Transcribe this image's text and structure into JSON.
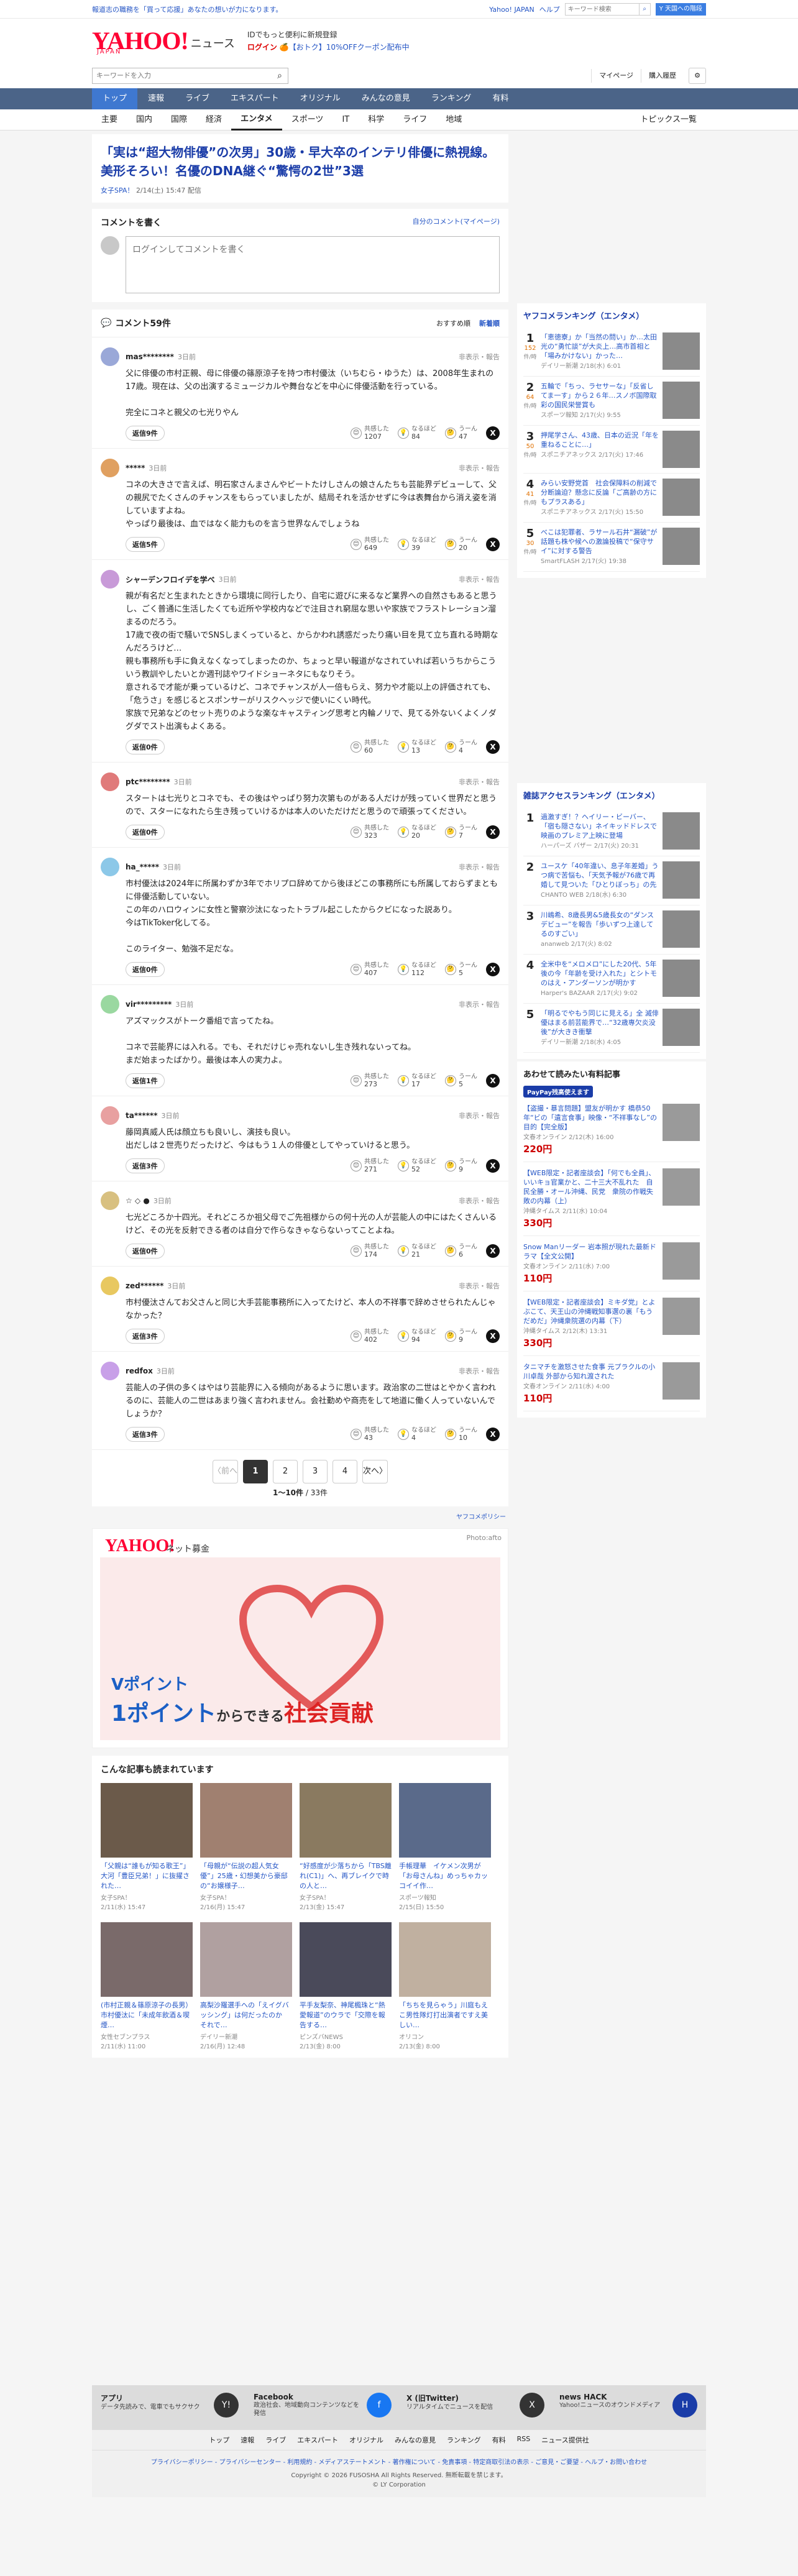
{
  "topbar": {
    "promo": "報道志の職務を「買って応援」あなたの想いが力になります。",
    "yahoo_japan": "Yahoo! JAPAN",
    "help": "ヘルプ",
    "mini_search_placeholder": "キーワード検索",
    "yj_button": "Y 天国への階段"
  },
  "header": {
    "logo": "YAHOO!",
    "logo_sub": "JAPAN",
    "service": "ニュース",
    "msg1": "IDでもっと便利に新規登録",
    "login": "ログイン",
    "msg2_pre": "【おトク】",
    "msg2": "10%OFFクーポン配布中"
  },
  "searchrow": {
    "placeholder": "キーワードを入力",
    "mypage": "マイページ",
    "history": "購入履歴"
  },
  "nav": [
    "トップ",
    "速報",
    "ライブ",
    "エキスパート",
    "オリジナル",
    "みんなの意見",
    "ランキング",
    "有料"
  ],
  "subnav": [
    "主要",
    "国内",
    "国際",
    "経済",
    "エンタメ",
    "スポーツ",
    "IT",
    "科学",
    "ライフ",
    "地域"
  ],
  "subnav_right": "トピックス一覧",
  "article": {
    "title": "「実は“超大物俳優”の次男」30歳・早大卒のインテリ俳優に熱視線。美形そろい！名優のDNA継ぐ“驚愕の2世”3選",
    "source": "女子SPA！",
    "date": "2/14(土) 15:47 配信"
  },
  "comment_form": {
    "heading": "コメントを書く",
    "mine": "自分のコメント(マイページ)",
    "placeholder": "ログインしてコメントを書く"
  },
  "comments_head": {
    "title": "コメント59件",
    "sort_rec": "おすすめ順",
    "sort_new": "新着順"
  },
  "react_labels": {
    "a": "共感した",
    "b": "なるほど",
    "c": "うーん",
    "report": "非表示・報告"
  },
  "comments": [
    {
      "user": "mas********",
      "time": "3日前",
      "body": "父に俳優の市村正親、母に俳優の篠原涼子を持つ市村優汰（いちむら・ゆうた）は、2008年生まれの17歳。現在は、父の出演するミュージカルや舞台などを中心に俳優活動を行っている。\n\n完全にコネと親父の七光りやん",
      "replies": "返信9件",
      "a": "1207",
      "b": "84",
      "c": "47"
    },
    {
      "user": "*****",
      "time": "3日前",
      "body": "コネの大きさで言えば、明石家さんまさんやビートたけしさんの娘さんたちも芸能界デビューして、父の親尻でたくさんのチャンスをもらっていましたが、結局それを活かせずに今は表舞台から消え姿を消していますよね。\nやっぱり最後は、血ではなく能力ものを言う世界なんでしょうね",
      "replies": "返信5件",
      "a": "649",
      "b": "39",
      "c": "20"
    },
    {
      "user": "シャーデンフロイデを学べ",
      "time": "3日前",
      "body": "親が有名だと生まれたときから環境に同行したり、自宅に遊びに来るなど業界への自然さもあると思うし、ごく普通に生活したくても近所や学校内などで注目され窮屈な思いや家族でフラストレーション溜まるのだろう。\n17歳で夜の街で騒いでSNSしまくっていると、からかわれ誘惑だったり痛い目を見て立ち直れる時期なんだろうけど…\n親も事務所も手に負えなくなってしまったのか、ちょっと早い報道がなされていれば若いうちからこういう教訓やしたいとか週刊誌やワイドショーネタにもなりそう。\n意されるで才能が乗っているけど、コネでチャンスが人一倍もらえ、努力や才能以上の評価されても、「危うさ」を感じるとスポンサーがリスクヘッジで使いにくい時代。\n家族で兄弟などのセット売りのような楽なキャスティング思考と内輪ノリで、見てる外ないくよくノダグダでスト出演もよくある。",
      "replies": "返信0件",
      "a": "60",
      "b": "13",
      "c": "4"
    },
    {
      "user": "ptc********",
      "time": "3日前",
      "body": "スタートは七光りとコネでも、その後はやっぱり努力次第ものがある人だけが残っていく世界だと思うので、スターになれたら生き残っていけるかは本人のいただけだと思うので頑張ってください。",
      "replies": "返信0件",
      "a": "323",
      "b": "20",
      "c": "7"
    },
    {
      "user": "ha_*****",
      "time": "3日前",
      "body": "市村優汰は2024年に所属わずか3年でホリプロ辞めてから後ほどこの事務所にも所属しておらずまともに俳優活動していない。\nこの年のハロウィンに女性と警察沙汰になったトラブル起こしたからクビになった説あり。\n今はTikToker化してる。\n\nこのライター、勉強不足だな。",
      "replies": "返信0件",
      "a": "407",
      "b": "112",
      "c": "5"
    },
    {
      "user": "vir*********",
      "time": "3日前",
      "body": "アズマックスがトーク番組で言ってたね。\n\nコネで芸能界には入れる。でも、それだけじゃ売れないし生き残れないってね。\nまだ始まったばかり。最後は本人の実力よ。",
      "replies": "返信1件",
      "a": "273",
      "b": "17",
      "c": "5"
    },
    {
      "user": "ta******",
      "time": "3日前",
      "body": "藤岡真威人氏は顔立ちも良いし、演技も良い。\n出だしは２世売りだったけど、今はもう１人の俳優としてやっていけると思う。",
      "replies": "返信3件",
      "a": "271",
      "b": "52",
      "c": "9"
    },
    {
      "user": "☆ ◇ ●",
      "time": "3日前",
      "body": "七光どころか十四光。それどころか祖父母でご先祖様からの何十光の人が芸能人の中にはたくさんいるけど、その光を反射できる者のは自分で作らなきゃならないってことよね。",
      "replies": "返信0件",
      "a": "174",
      "b": "21",
      "c": "6"
    },
    {
      "user": "zed******",
      "time": "3日前",
      "body": "市村優汰さんてお父さんと同じ大手芸能事務所に入ってたけど、本人の不祥事で辞めさせられたんじゃなかった？",
      "replies": "返信3件",
      "a": "402",
      "b": "94",
      "c": "9"
    },
    {
      "user": "redfox",
      "time": "3日前",
      "body": "芸能人の子供の多くはやはり芸能界に入る傾向があるように思います。政治家の二世はとやかく言われるのに、芸能人の二世はあまり強く言われません。会社勤めや商売をして地道に働く人っていないんでしょうか？",
      "replies": "返信3件",
      "a": "43",
      "b": "4",
      "c": "10"
    }
  ],
  "pager": {
    "prev": "〈前へ",
    "pages": [
      "1",
      "2",
      "3",
      "4"
    ],
    "next": "次へ〉",
    "count_range": "1〜10件",
    "count_total": "/ 33件"
  },
  "policy": "ヤフコメポリシー",
  "ad": {
    "logo": "YAHOO!",
    "label": "ネット募金",
    "photo": "Photo:afto",
    "line1": "Vポイント",
    "line2_pre": "1ポイント",
    "line2_mid": "からできる",
    "line2_post": "社会貢献"
  },
  "related": {
    "heading": "こんな記事も読まれています",
    "items": [
      {
        "title": "「父親は“誰もが知る歌王”」大河「豊臣兄弟！」に抜擢された…",
        "src": "女子SPA！",
        "date": "2/11(水) 15:47"
      },
      {
        "title": "「母親が“伝説の超人気女優”」25歳・幻想美から豪邸の“お嬢様子…",
        "src": "女子SPA！",
        "date": "2/16(月) 15:47"
      },
      {
        "title": "“好感度が少落ちから「TBS離れ(C1)」へ、再ブレイクで時の人と…",
        "src": "女子SPA！",
        "date": "2/13(金) 15:47"
      },
      {
        "title": "手帳理華　イケメン次男が「お母さんね」めっちゃカッコイイ作…",
        "src": "スポーツ報知",
        "date": "2/15(日) 15:50"
      },
      {
        "title": "(市村正親＆篠原涼子の長男）市村優汰に「未成年飲酒＆喫煙…",
        "src": "女性セブンプラス",
        "date": "2/11(水) 11:00"
      },
      {
        "title": "高梨沙羅選手への「えイグバッシング」は何だったのか　それで…",
        "src": "デイリー新潮",
        "date": "2/16(月) 12:48"
      },
      {
        "title": "平手友梨奈、神尾楓珠と“熱愛報道”のウラで「交際を報告する…",
        "src": "ピンズバNEWS",
        "date": "2/13(金) 8:00"
      },
      {
        "title": "「ちちを見らゃう」川庭もえこ男性隊灯打出演者ですえ美しい…",
        "src": "オリコン",
        "date": "2/13(金) 8:00"
      }
    ]
  },
  "side": {
    "ranking_heading": "ヤフコメランキング（エンタメ）",
    "ranking": [
      {
        "no": "1",
        "cnt": "152",
        "unit": "件/時",
        "title": "「恵徳寮」か「当然の問い」か…太田光の“勇忙談”が大炎上…高市首相と「場みかけない」かった…",
        "meta": "デイリー新潮 2/18(水) 6:01"
      },
      {
        "no": "2",
        "cnt": "64",
        "unit": "件/時",
        "title": "五輪で「ちっ、ラセサーな」「反省してま一す」から２６年…スノボ国際取彩の国民栄誉賞も",
        "meta": "スポーツ報知 2/17(火) 9:55"
      },
      {
        "no": "3",
        "cnt": "50",
        "unit": "件/時",
        "title": "押尾学さん、43歳、日本の近況「年を重ねることに…」",
        "meta": "スポニチアネックス 2/17(火) 17:46"
      },
      {
        "no": "4",
        "cnt": "41",
        "unit": "件/時",
        "title": "みらい安野党首　社会保障料の削減で分断論迫？懸念に反論「ご高齢の方にもプラスある」",
        "meta": "スポニチアネックス 2/17(火) 15:50"
      },
      {
        "no": "5",
        "cnt": "30",
        "unit": "件/時",
        "title": "べこは犯罪者、ラサール石井“漏破”が話題も株や候への激論投稿で“保守サイ”に対する警告",
        "meta": "SmartFLASH 2/17(火) 19:38"
      }
    ],
    "access_heading": "雑誌アクセスランキング（エンタメ）",
    "access": [
      {
        "no": "1",
        "title": "過激すぎ！？ヘイリー・ビーバー、「宿も隠さない」ネイキッドドレスで映画のプレミア上映に登場",
        "meta": "ハーパーズ バザー 2/17(火) 20:31"
      },
      {
        "no": "2",
        "title": "ユースケ「40年違い、息子年差婚」うつ病で苦悩も、「天気予報が76歳で再婚して見ついた「ひとりぼっち」の先",
        "meta": "CHANTO WEB 2/18(水) 6:30"
      },
      {
        "no": "3",
        "title": "川嶋希、8歳長男&5歳長女の“ダンスデビュー”を報告「歩いずつ上達してるのすごい」",
        "meta": "ananweb 2/17(火) 8:02"
      },
      {
        "no": "4",
        "title": "全米中を“メロメロ”にした20代、5年後の今「年齢を受け入れた」とシトモのはえ・アンダーソンが明かす",
        "meta": "Harper's BAZAAR 2/17(火) 9:02"
      },
      {
        "no": "5",
        "title": "「明るでやもう同じに見える」全 滅俳優はまる前芸能界で…“32歳専欠炎没後”が大きき衝撃",
        "meta": "デイリー新潮 2/18(水) 4:05"
      }
    ],
    "paid_heading": "あわせて読みたい有料記事",
    "paid_label": "PayPay残高使えます",
    "paid": [
      {
        "title": "【盗撮・暴言問題】盟友が明かす 橋恭50年“ビの「遺言食事」映像・“不祥事なし”の目的【完全版】",
        "meta": "文春オンライン 2/12(木) 16:00",
        "price": "220円"
      },
      {
        "title": "【WEB限定・記者座談会】「何でも全員」、いいキョ官業かと、二十三大不乱れた　自民全勝・オール沖縄、民党　衆院の作戦失敗の内幕（上）",
        "meta": "沖縄タイムス 2/11(水) 10:04",
        "price": "330円"
      },
      {
        "title": "Snow Manリーダー 岩本照が現れた最新ドラマ【全文公開】",
        "meta": "文春オンライン 2/11(水) 7:00",
        "price": "110円"
      },
      {
        "title": "【WEB限定・記者座談会】ミキダ党」とよぶこて、天王山の沖縄戦知事選の裏「もうだめだ」沖縄衆院選の内幕（下）",
        "meta": "沖縄タイムス 2/12(木) 13:31",
        "price": "330円"
      },
      {
        "title": "タニマチを激怒させた食事 元プラクルの小川卓哉 外部から知れ渡された",
        "meta": "文春オンライン 2/11(水) 4:00",
        "price": "110円"
      }
    ]
  },
  "footer": {
    "apps": [
      {
        "title": "アプリ",
        "desc": "データ先読みで、電車でもサクサク",
        "icon": "Y!"
      },
      {
        "title": "Facebook",
        "desc": "政治社会、地域動向コンテンツなどを発信",
        "icon": "f"
      },
      {
        "title": "X (旧Twitter)",
        "desc": "リアルタイムでニュースを配信",
        "icon": "X"
      },
      {
        "title": "news HACK",
        "desc": "Yahoo!ニュースのオウンドメディア",
        "icon": "H"
      }
    ],
    "nav": [
      "トップ",
      "速報",
      "ライブ",
      "エキスパート",
      "オリジナル",
      "みんなの意見",
      "ランキング",
      "有料",
      "RSS",
      "ニュース提供社"
    ],
    "links": "プライバシーポリシー - プライバシーセンター - 利用規約 - メディアステートメント - 著作権について - 免責事項 - 特定商取引法の表示 - ご意見・ご要望 - ヘルプ・お問い合わせ",
    "copy": "Copyright © 2026 FUSOSHA All Rights Reserved. 無断転載を禁じます。",
    "corp": "© LY Corporation"
  }
}
